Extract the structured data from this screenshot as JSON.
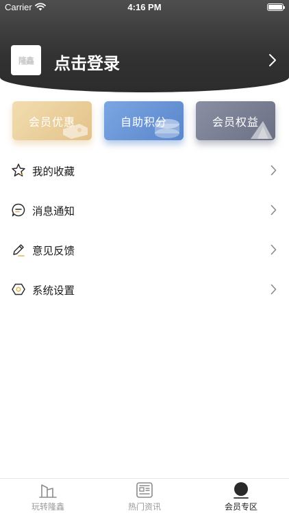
{
  "status_bar": {
    "carrier": "Carrier",
    "time": "4:16 PM",
    "wifi_icon": "wifi-icon",
    "battery_level": 1.0
  },
  "header": {
    "logo_text": "隆鑫",
    "login_label": "点击登录",
    "chevron_icon": "chevron-right-icon",
    "gradient_colors": [
      "#4e4e4e",
      "#2c2c2c"
    ]
  },
  "cards": [
    {
      "label": "会员优惠",
      "color": "#e8c994",
      "icon": "coupon-icon"
    },
    {
      "label": "自助积分",
      "color": "#6a96d8",
      "icon": "coin-icon"
    },
    {
      "label": "会员权益",
      "color": "#7a7f93",
      "icon": "diamond-icon"
    }
  ],
  "menu": [
    {
      "label": "我的收藏",
      "icon": "star-icon"
    },
    {
      "label": "消息通知",
      "icon": "message-icon"
    },
    {
      "label": "意见反馈",
      "icon": "pencil-icon"
    },
    {
      "label": "系统设置",
      "icon": "settings-hexagon-icon"
    }
  ],
  "tabbar": {
    "tabs": [
      {
        "label": "玩转隆鑫",
        "icon": "buildings-icon",
        "active": false
      },
      {
        "label": "热门资讯",
        "icon": "news-icon",
        "active": false
      },
      {
        "label": "会员专区",
        "icon": "member-icon",
        "active": true
      }
    ],
    "active_color": "#222222",
    "inactive_color": "#9a9a9a"
  }
}
